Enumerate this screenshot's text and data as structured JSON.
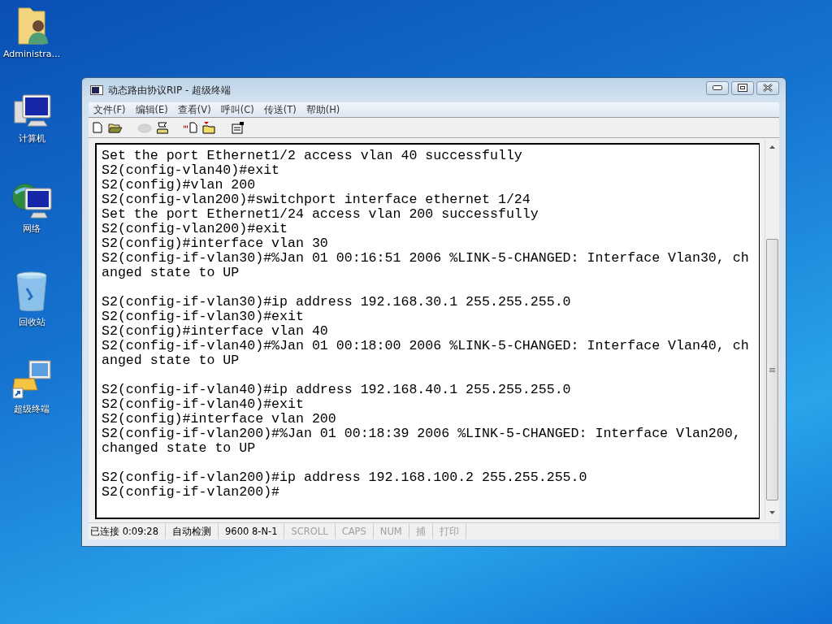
{
  "desktop_icons": [
    {
      "kind": "user-folder",
      "label": "Administra..."
    },
    {
      "kind": "computer",
      "label": "计算机"
    },
    {
      "kind": "network",
      "label": "网络"
    },
    {
      "kind": "recycle-bin",
      "label": "回收站"
    },
    {
      "kind": "terminal-shortcut",
      "label": "超级终端"
    }
  ],
  "window": {
    "title": "动态路由协议RIP - 超级终端",
    "menu": [
      "文件(F)",
      "编辑(E)",
      "查看(V)",
      "呼叫(C)",
      "传送(T)",
      "帮助(H)"
    ],
    "toolbar": [
      {
        "kind": "new",
        "disabled": false
      },
      {
        "kind": "open",
        "disabled": false
      },
      {
        "kind": "disconnect",
        "disabled": true
      },
      {
        "kind": "call",
        "disabled": false
      },
      {
        "kind": "send",
        "disabled": false
      },
      {
        "kind": "receive",
        "disabled": false
      },
      {
        "kind": "properties",
        "disabled": false
      }
    ],
    "terminal_blocks": [
      [
        "Set the port Ethernet1/2 access vlan 40 successfully",
        "S2(config-vlan40)#exit",
        "S2(config)#vlan 200",
        "S2(config-vlan200)#switchport interface ethernet 1/24",
        "Set the port Ethernet1/24 access vlan 200 successfully",
        "S2(config-vlan200)#exit",
        "S2(config)#interface vlan 30",
        "S2(config-if-vlan30)#%Jan 01 00:16:51 2006 %LINK-5-CHANGED: Interface Vlan30, changed state to UP"
      ],
      [
        "S2(config-if-vlan30)#ip address 192.168.30.1 255.255.255.0",
        "S2(config-if-vlan30)#exit",
        "S2(config)#interface vlan 40",
        "S2(config-if-vlan40)#%Jan 01 00:18:00 2006 %LINK-5-CHANGED: Interface Vlan40, changed state to UP"
      ],
      [
        "S2(config-if-vlan40)#ip address 192.168.40.1 255.255.255.0",
        "S2(config-if-vlan40)#exit",
        "S2(config)#interface vlan 200",
        "S2(config-if-vlan200)#%Jan 01 00:18:39 2006 %LINK-5-CHANGED: Interface Vlan200, changed state to UP"
      ],
      [
        "S2(config-if-vlan200)#ip address 192.168.100.2 255.255.255.0",
        "S2(config-if-vlan200)#"
      ]
    ],
    "status_bar": [
      {
        "text": "已连接 0:09:28",
        "disabled": false
      },
      {
        "text": "自动检测",
        "disabled": false
      },
      {
        "text": "9600 8-N-1",
        "disabled": false
      },
      {
        "text": "SCROLL",
        "disabled": true
      },
      {
        "text": "CAPS",
        "disabled": true
      },
      {
        "text": "NUM",
        "disabled": true
      },
      {
        "text": "捕",
        "disabled": true
      },
      {
        "text": "打印",
        "disabled": true
      }
    ]
  }
}
